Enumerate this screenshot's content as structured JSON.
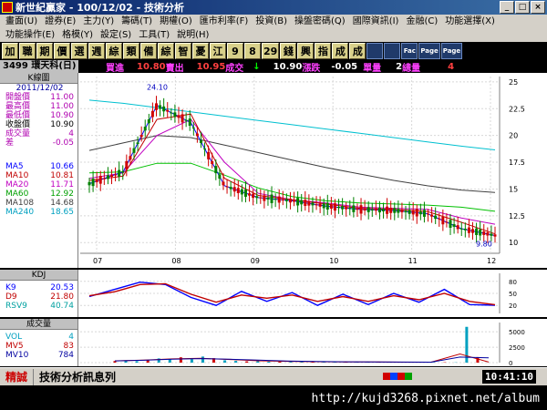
{
  "window": {
    "title": "新世紀贏家 - 100/12/02 - 技術分析",
    "btn_min": "_",
    "btn_max": "□",
    "btn_close": "×"
  },
  "menu": [
    "畫面(U)",
    "證券(E)",
    "主力(Y)",
    "籌碼(T)",
    "期權(O)",
    "匯市利率(F)",
    "投資(B)",
    "操盤密碼(Q)",
    "國際資訊(I)",
    "金融(C)",
    "功能選擇(X)",
    "功能操作(E)",
    "格模(Y)",
    "設定(S)",
    "工具(T)",
    "說明(H)"
  ],
  "toolbar": [
    "加",
    "職",
    "期",
    "價",
    "選",
    "週",
    "綜",
    "類",
    "備",
    "綜",
    "智",
    "憂",
    "江",
    "9",
    "8",
    "29",
    "錢",
    "興",
    "指",
    "成",
    "成",
    "",
    "",
    "Fac",
    "Page",
    "Page"
  ],
  "info": {
    "stock": "3499 環天科(日)",
    "buy_label": "買進",
    "buy_value": "10.80",
    "sell_label": "賣出",
    "sell_value": "10.95",
    "trade_label": "成交",
    "trade_arrow": "↓",
    "trade_value": "10.90",
    "change_label": "漲跌",
    "change_value": "-0.05",
    "volume_label": "單量",
    "volume_value": "2",
    "total_label": "總量",
    "total_value": "4"
  },
  "kpanel": {
    "title": "K線圖",
    "date": "2011/12/02",
    "rows": [
      {
        "label": "開盤價",
        "value": "11.00",
        "color": "#b000b0"
      },
      {
        "label": "最高價",
        "value": "11.00",
        "color": "#b000b0"
      },
      {
        "label": "最低價",
        "value": "10.90",
        "color": "#b000b0"
      },
      {
        "label": "收盤價",
        "value": "10.90",
        "color": "#000"
      },
      {
        "label": "成交量",
        "value": "4",
        "color": "#b000b0"
      },
      {
        "label": "差",
        "value": "-0.05",
        "color": "#b000b0"
      }
    ],
    "ma": [
      {
        "label": "MA5",
        "value": "10.66",
        "color": "#0000ff"
      },
      {
        "label": "MA10",
        "value": "10.81",
        "color": "#c00000"
      },
      {
        "label": "MA20",
        "value": "11.71",
        "color": "#c000c0"
      },
      {
        "label": "MA60",
        "value": "12.92",
        "color": "#00a000"
      },
      {
        "label": "MA108",
        "value": "14.68",
        "color": "#404040"
      },
      {
        "label": "MA240",
        "value": "18.65",
        "color": "#00a0c0"
      }
    ]
  },
  "kdpanel": {
    "title": "KDJ",
    "rows": [
      {
        "label": "K9",
        "value": "20.53",
        "color": "#0000ff"
      },
      {
        "label": "D9",
        "value": "21.80",
        "color": "#c00000"
      },
      {
        "label": "RSV9",
        "value": "40.74",
        "color": "#00a0a0"
      }
    ]
  },
  "volpanel": {
    "title": "成交量",
    "rows": [
      {
        "label": "VOL",
        "value": "4",
        "color": "#00a0c0"
      },
      {
        "label": "MV5",
        "value": "83",
        "color": "#c00000"
      },
      {
        "label": "MV10",
        "value": "784",
        "color": "#0000a0"
      }
    ]
  },
  "colors": {
    "up": "#d00000",
    "down": "#008000",
    "panel_bg": "#ffffff",
    "grid": "#c0c0c0"
  },
  "chart_data": [
    {
      "type": "line",
      "title": "K線圖",
      "x_ticks": [
        "07",
        "08",
        "09",
        "10",
        "11",
        "12"
      ],
      "ylim": [
        9,
        25.5
      ],
      "y_ticks": [
        10.0,
        12.5,
        15.0,
        17.5,
        20.0,
        22.5,
        25.0
      ],
      "annotations": [
        {
          "text": "24.10",
          "value": 24.1
        },
        {
          "text": "9.80",
          "value": 9.8
        }
      ],
      "series": [
        {
          "name": "MA240",
          "color": "#00c0d0",
          "values": [
            23.3,
            23.0,
            22.6,
            22.2,
            21.8,
            21.4,
            21.0,
            20.6,
            20.2,
            19.8,
            19.4,
            19.0,
            18.65
          ]
        },
        {
          "name": "MA108",
          "color": "#404040",
          "values": [
            18.6,
            19.3,
            20.0,
            19.8,
            19.1,
            18.4,
            17.7,
            17.0,
            16.4,
            15.8,
            15.3,
            14.9,
            14.68
          ]
        },
        {
          "name": "MA60",
          "color": "#00c000",
          "values": [
            16.5,
            16.6,
            17.4,
            17.4,
            16.3,
            15.1,
            14.3,
            13.9,
            13.7,
            13.6,
            13.5,
            13.3,
            12.92
          ]
        },
        {
          "name": "MA20",
          "color": "#c000c0",
          "values": [
            16.0,
            16.5,
            20.0,
            21.5,
            17.5,
            14.6,
            14.0,
            13.7,
            13.3,
            13.2,
            13.1,
            12.3,
            11.71
          ]
        },
        {
          "name": "MA10",
          "color": "#c00000",
          "values": [
            15.8,
            16.2,
            21.5,
            22.0,
            16.0,
            14.4,
            14.0,
            13.6,
            13.2,
            13.1,
            12.9,
            11.9,
            10.81
          ]
        },
        {
          "name": "MA5",
          "color": "#0000ff",
          "values": [
            15.5,
            16.6,
            22.8,
            21.2,
            15.3,
            14.2,
            13.9,
            13.4,
            13.1,
            13.0,
            12.7,
            11.3,
            10.66
          ]
        }
      ]
    },
    {
      "type": "line",
      "title": "KDJ",
      "ylim": [
        0,
        100
      ],
      "y_ticks": [
        20,
        50,
        80
      ],
      "series": [
        {
          "name": "K9",
          "color": "#0000ff",
          "values": [
            42,
            60,
            78,
            72,
            40,
            20,
            55,
            30,
            52,
            20,
            48,
            22,
            50,
            28,
            60,
            22,
            20.53
          ]
        },
        {
          "name": "D9",
          "color": "#c00000",
          "values": [
            44,
            54,
            72,
            74,
            48,
            28,
            46,
            38,
            46,
            30,
            42,
            30,
            44,
            34,
            50,
            30,
            21.8
          ]
        }
      ]
    },
    {
      "type": "bar",
      "title": "成交量",
      "ylim": [
        0,
        6500
      ],
      "y_ticks": [
        0,
        2500,
        5000
      ],
      "values": [
        260,
        300,
        240,
        420,
        680,
        520,
        860,
        560,
        980,
        720,
        380,
        300,
        210,
        240,
        170,
        150,
        130,
        160,
        110,
        100,
        120,
        90,
        80,
        100,
        90,
        70,
        80,
        60,
        70,
        50,
        60,
        40,
        5800,
        900,
        4
      ],
      "series": [
        {
          "name": "MV5",
          "color": "#c00000",
          "values": [
            300,
            400,
            600,
            700,
            500,
            300,
            200,
            150,
            120,
            100,
            80,
            70,
            1400,
            83
          ]
        },
        {
          "name": "MV10",
          "color": "#0000a0",
          "values": [
            280,
            380,
            550,
            650,
            550,
            400,
            260,
            180,
            130,
            110,
            90,
            75,
            900,
            784
          ]
        }
      ]
    }
  ],
  "status": {
    "badge": "精誠",
    "message": "技術分析訊息列",
    "clock": "10:41:10"
  },
  "footer": {
    "text": "http://kujd3268.pixnet.net/album"
  }
}
